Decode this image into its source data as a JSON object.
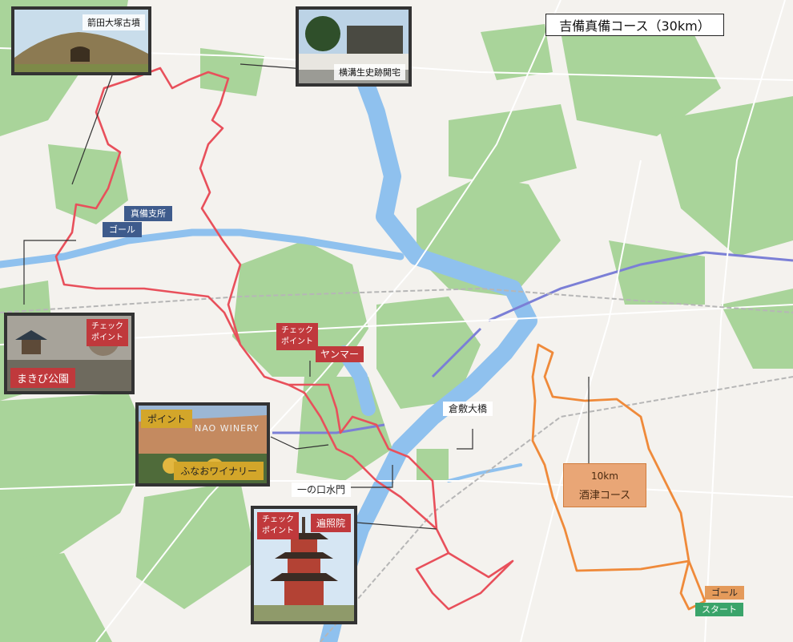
{
  "title": "吉備真備コース（30km）",
  "photos": {
    "kofun": {
      "caption": "箭田大塚古墳"
    },
    "yokomizo": {
      "caption": "横溝生史跡開宅"
    },
    "makibi": {
      "caption": "まきび公園",
      "check_line1": "チェック",
      "check_line2": "ポイント"
    },
    "winery": {
      "caption": "ふなおワイナリー",
      "point": "ポイント",
      "sign": "NAO WINERY"
    },
    "henjoin": {
      "caption": "遍照院",
      "check_line1": "チェック",
      "check_line2": "ポイント"
    }
  },
  "labels": {
    "mabi_branch": "真備支所",
    "goal_main": "ゴール",
    "yanmar_check1": "チェック",
    "yanmar_check2": "ポイント",
    "yanmar": "ヤンマー",
    "kurashiki_bridge": "倉敷大橋",
    "ichinokuchi": "一の口水門",
    "sakazu_km": "10km",
    "sakazu_course": "酒津コース",
    "goal_sub": "ゴール",
    "start": "スタート"
  },
  "colors": {
    "land": "#f4f2ee",
    "forest": "#a9d49a",
    "water": "#8fc1ee",
    "route_red": "#e8505b",
    "route_orange": "#ef8a3a",
    "highway": "#7b7fd6"
  }
}
